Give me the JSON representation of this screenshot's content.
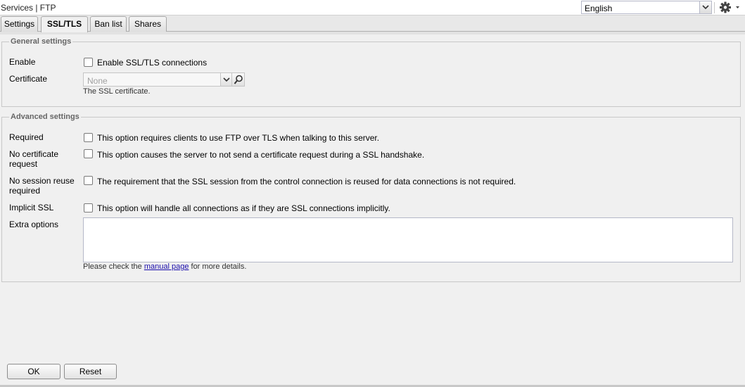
{
  "header": {
    "breadcrumb": "Services | FTP",
    "language": {
      "selected": "English"
    }
  },
  "tabs": [
    {
      "label": "Settings",
      "active": false
    },
    {
      "label": "SSL/TLS",
      "active": true
    },
    {
      "label": "Ban list",
      "active": false
    },
    {
      "label": "Shares",
      "active": false
    }
  ],
  "general": {
    "legend": "General settings",
    "enable_label": "Enable",
    "enable_checkbox_label": "Enable SSL/TLS connections",
    "enable_checked": false,
    "certificate_label": "Certificate",
    "certificate_value": "None",
    "certificate_hint": "The SSL certificate."
  },
  "advanced": {
    "legend": "Advanced settings",
    "required_label": "Required",
    "required_text": "This option requires clients to use FTP over TLS when talking to this server.",
    "nocert_label_1": "No certificate",
    "nocert_label_2": "request",
    "nocert_text": "This option causes the server to not send a certificate request during a SSL handshake.",
    "noreuse_label_1": "No session reuse",
    "noreuse_label_2": "required",
    "noreuse_text": "The requirement that the SSL session from the control connection is reused for data connections is not required.",
    "implicit_label": "Implicit SSL",
    "implicit_text": "This option will handle all connections as if they are SSL connections implicitly.",
    "extra_label": "Extra options",
    "extra_value": "",
    "extra_hint_prefix": "Please check the ",
    "extra_hint_link": "manual page",
    "extra_hint_suffix": " for more details."
  },
  "buttons": {
    "ok": "OK",
    "reset": "Reset"
  },
  "icons": {
    "language_dropdown": "chevron-down-icon",
    "settings": "gear-icon",
    "certificate_dropdown": "chevron-down-icon",
    "certificate_search": "magnifier-icon"
  },
  "colors": {
    "background": "#f0f0f0",
    "link": "#1a0dab",
    "legend": "#666666"
  }
}
